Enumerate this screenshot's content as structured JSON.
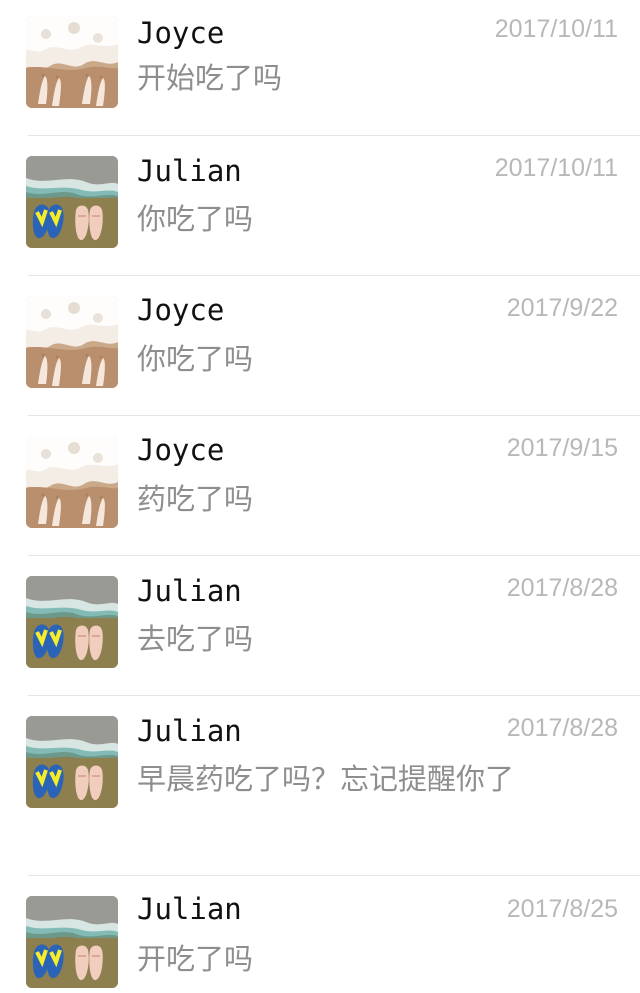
{
  "conversations": [
    {
      "name": "Joyce",
      "date": "2017/10/11",
      "message": "开始吃了吗",
      "avatar": "beach-feet-avatar"
    },
    {
      "name": "Julian",
      "date": "2017/10/11",
      "message": "你吃了吗",
      "avatar": "flip-flops-avatar"
    },
    {
      "name": "Joyce",
      "date": "2017/9/22",
      "message": "你吃了吗",
      "avatar": "beach-feet-avatar"
    },
    {
      "name": "Joyce",
      "date": "2017/9/15",
      "message": "药吃了吗",
      "avatar": "beach-feet-avatar"
    },
    {
      "name": "Julian",
      "date": "2017/8/28",
      "message": "去吃了吗",
      "avatar": "flip-flops-avatar"
    },
    {
      "name": "Julian",
      "date": "2017/8/28",
      "message": "早晨药吃了吗？忘记提醒你了",
      "avatar": "flip-flops-avatar"
    },
    {
      "name": "Julian",
      "date": "2017/8/25",
      "message": "开吃了吗",
      "avatar": "flip-flops-avatar"
    }
  ],
  "colors": {
    "name": "#111111",
    "message": "#8e8e8e",
    "date": "#b8b8b8",
    "divider": "#e4e4e4"
  }
}
